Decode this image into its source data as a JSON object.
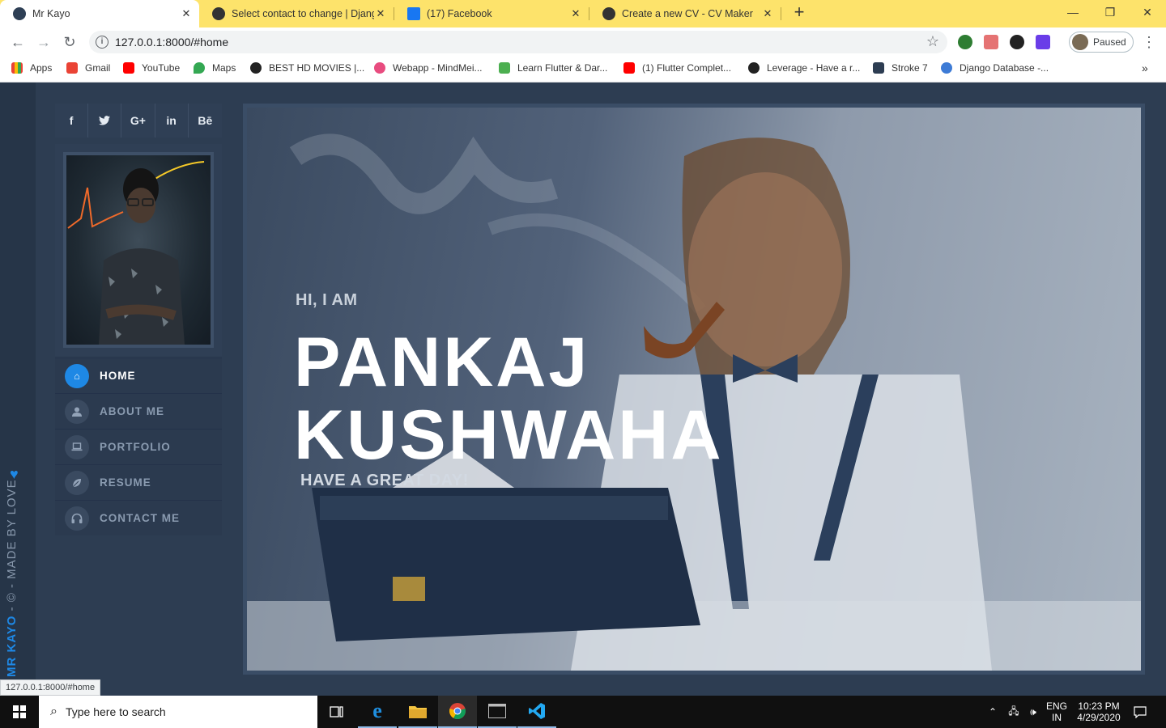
{
  "browser": {
    "tabs": [
      {
        "title": "Mr Kayo",
        "active": true
      },
      {
        "title": "Select contact to change | Django"
      },
      {
        "title": "(17) Facebook"
      },
      {
        "title": "Create a new CV - CV Maker"
      }
    ],
    "close_glyph": "✕",
    "new_tab_glyph": "+",
    "url": "127.0.0.1:8000/#home",
    "profile_status": "Paused",
    "bookmarks": [
      {
        "label": "Apps"
      },
      {
        "label": "Gmail"
      },
      {
        "label": "YouTube"
      },
      {
        "label": "Maps"
      },
      {
        "label": "BEST HD MOVIES |..."
      },
      {
        "label": "Webapp - MindMei..."
      },
      {
        "label": "Learn Flutter & Dar..."
      },
      {
        "label": "(1) Flutter Complet..."
      },
      {
        "label": "Leverage - Have a r..."
      },
      {
        "label": "Stroke 7"
      },
      {
        "label": "Django Database -..."
      }
    ],
    "status_url": "127.0.0.1:8000/#home"
  },
  "site": {
    "social": [
      {
        "name": "facebook-icon",
        "glyph": "f"
      },
      {
        "name": "twitter-icon",
        "glyph": "🐦"
      },
      {
        "name": "google-plus-icon",
        "glyph": "G+"
      },
      {
        "name": "linkedin-icon",
        "glyph": "in"
      },
      {
        "name": "behance-icon",
        "glyph": "Bē"
      }
    ],
    "nav": [
      {
        "label": "HOME",
        "icon": "home-icon",
        "glyph": "⌂",
        "active": true
      },
      {
        "label": "ABOUT ME",
        "icon": "user-icon",
        "glyph": "👤"
      },
      {
        "label": "PORTFOLIO",
        "icon": "laptop-icon",
        "glyph": "▭"
      },
      {
        "label": "RESUME",
        "icon": "leaf-icon",
        "glyph": "✎"
      },
      {
        "label": "CONTACT ME",
        "icon": "headphones-icon",
        "glyph": "∩"
      }
    ],
    "hero": {
      "greeting": "HI, I AM",
      "name_line1": "PANKAJ",
      "name_line2": "KUSHWAHA",
      "subtitle": "HAVE A GREAT DAY!"
    },
    "credit": {
      "brand": "MR KAYO",
      "rest": " - © - MADE BY LOVE",
      "heart": "♥"
    },
    "accent_color": "#1e88e5"
  },
  "taskbar": {
    "search_placeholder": "Type here to search",
    "language_line1": "ENG",
    "language_line2": "IN",
    "time": "10:23 PM",
    "date": "4/29/2020"
  }
}
